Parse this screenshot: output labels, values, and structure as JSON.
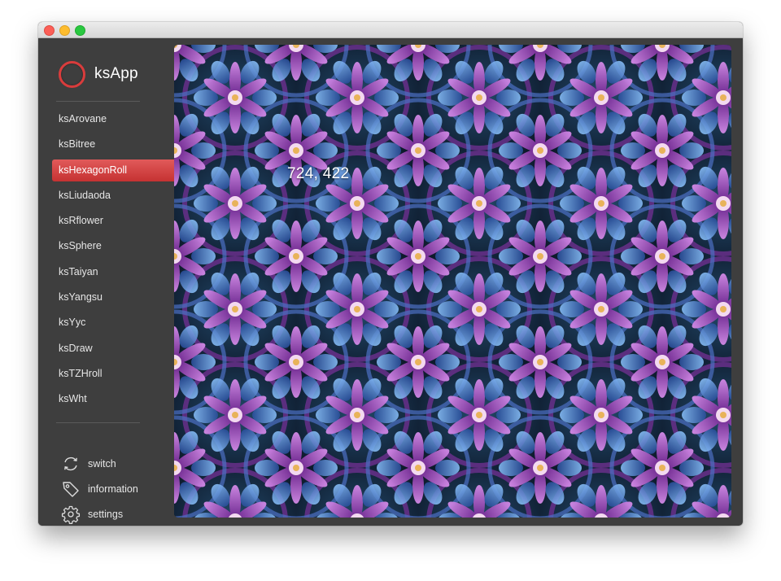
{
  "window": {
    "controls": [
      "close",
      "minimize",
      "zoom"
    ]
  },
  "app": {
    "name": "ksApp"
  },
  "sidebar": {
    "items": [
      {
        "label": "ksArovane"
      },
      {
        "label": "ksBitree"
      },
      {
        "label": "ksHexagonRoll",
        "selected": true
      },
      {
        "label": "ksLiudaoda"
      },
      {
        "label": "ksRflower"
      },
      {
        "label": "ksSphere"
      },
      {
        "label": "ksTaiyan"
      },
      {
        "label": "ksYangsu"
      },
      {
        "label": "ksYyc"
      },
      {
        "label": "ksDraw"
      },
      {
        "label": "ksTZHroll"
      },
      {
        "label": "ksWht"
      }
    ],
    "footer": [
      {
        "label": "switch",
        "icon": "switch-icon"
      },
      {
        "label": "information",
        "icon": "tag-icon"
      },
      {
        "label": "settings",
        "icon": "gear-icon"
      }
    ]
  },
  "canvas": {
    "coordinate_readout": "724, 422"
  },
  "colors": {
    "accent": "#d93c3c",
    "sidebar_bg": "#3e3e3e",
    "canvas_purple": "#9c3cbf",
    "canvas_blue": "#4d8fe0"
  }
}
